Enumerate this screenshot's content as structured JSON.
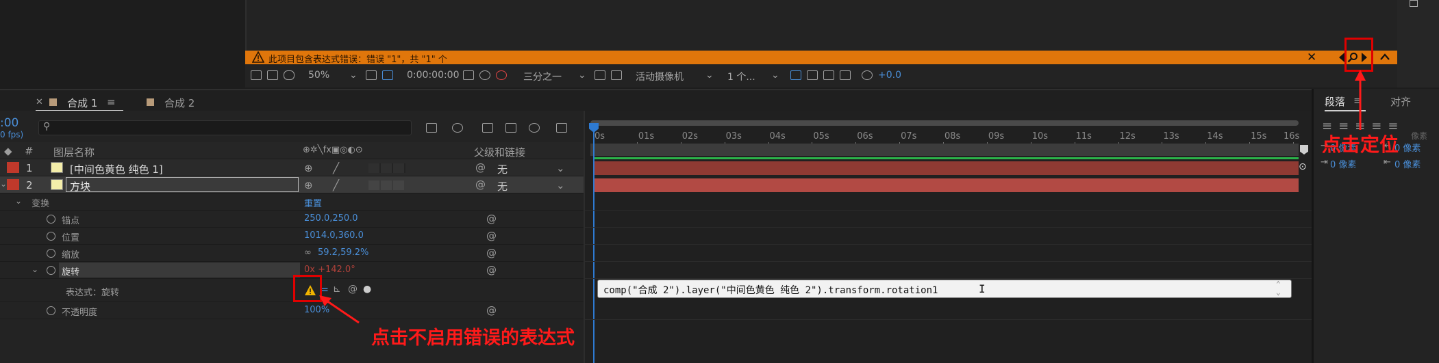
{
  "colors": {
    "warning_bar": "#e0760b",
    "accent_blue": "#4a8fd9",
    "annotation_red": "#ff1a1a",
    "layer_label_red": "#c0392b",
    "layer_bar_red": "#8f3a33",
    "layer_bar_red2": "#b24a44"
  },
  "warning": {
    "text": "此项目包含表达式错误：错误 \"1\"，共 \"1\" 个",
    "close": "✕"
  },
  "toolbar": {
    "zoom": "50%",
    "timecode": "0:00:00:00",
    "resolution": "三分之一",
    "camera": "活动摄像机",
    "views": "1 个...",
    "exposure": "+0.0"
  },
  "tabs": {
    "comp1": "合成 1",
    "comp2": "合成 2",
    "menu": "≡"
  },
  "left": {
    "time": ":00",
    "fps": "0 fps)",
    "col_layer_name": "图层名称",
    "col_parent": "父级和链接",
    "col_num": "#"
  },
  "layers": [
    {
      "num": "1",
      "name": "[中间色黄色 纯色 1]",
      "parent": "无"
    },
    {
      "num": "2",
      "name": "方块",
      "parent": "无"
    }
  ],
  "props": {
    "transform": "变换",
    "reset": "重置",
    "anchor": {
      "label": "锚点",
      "value": "250.0,250.0"
    },
    "position": {
      "label": "位置",
      "value": "1014.0,360.0"
    },
    "scale": {
      "label": "缩放",
      "value": "59.2,59.2%"
    },
    "rotation": {
      "label": "旋转",
      "value": "0x +142.0°"
    },
    "expression": {
      "label": "表达式：旋转"
    },
    "opacity": {
      "label": "不透明度",
      "value": "100%"
    }
  },
  "ruler": [
    "0s",
    "01s",
    "02s",
    "03s",
    "04s",
    "05s",
    "06s",
    "07s",
    "08s",
    "09s",
    "10s",
    "11s",
    "12s",
    "13s",
    "14s",
    "15s",
    "16s"
  ],
  "expression_text": "comp(\"合成 2\").layer(\"中间色黄色 纯色 2\").transform.rotation1",
  "right_panel": {
    "tab1": "段落",
    "tab2": "对齐",
    "px1": "0 像素",
    "px2": "0 像素",
    "px3": "0 像素",
    "px4": "0 像素",
    "px5": "像素"
  },
  "annotations": {
    "locate": "点击定位",
    "disable": "点击不启用错误的表达式"
  }
}
